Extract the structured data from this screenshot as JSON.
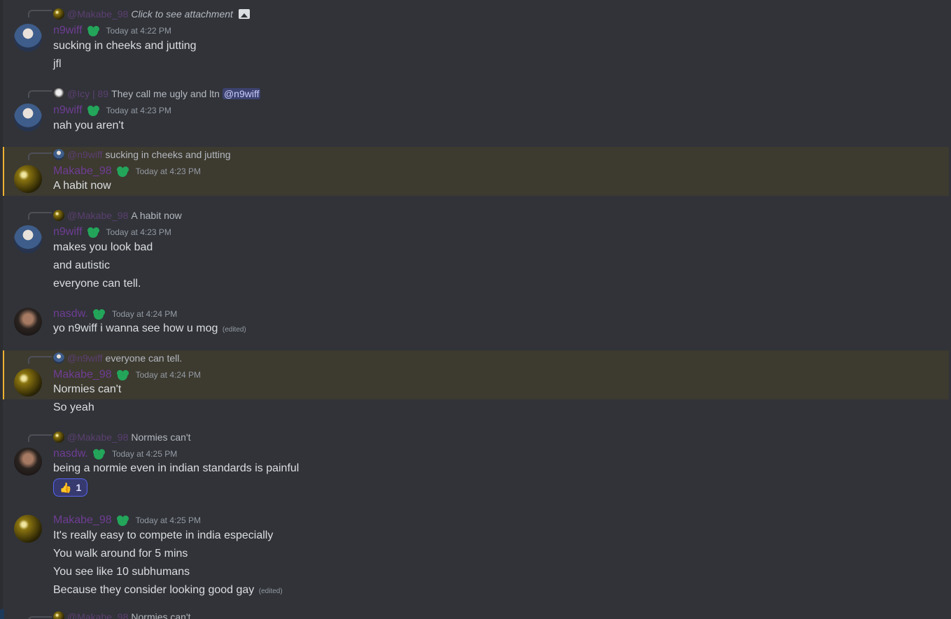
{
  "messages": [
    {
      "reply": {
        "user": "@Makabe_98",
        "text": "Click to see attachment",
        "italic": true,
        "has_image_icon": true
      },
      "user": "n9wiff",
      "timestamp": "Today at 4:22 PM",
      "lines": [
        "sucking in cheeks and jutting",
        "jfl"
      ]
    },
    {
      "reply": {
        "user": "@Icy | 89",
        "text": "They call me ugly and ltn",
        "mention": "@n9wiff"
      },
      "user": "n9wiff",
      "timestamp": "Today at 4:23 PM",
      "lines": [
        "nah you aren't"
      ]
    },
    {
      "highlighted": true,
      "reply": {
        "user": "@n9wiff",
        "text": "sucking in cheeks and jutting"
      },
      "user": "Makabe_98",
      "timestamp": "Today at 4:23 PM",
      "lines": [
        "A habit now"
      ]
    },
    {
      "reply": {
        "user": "@Makabe_98",
        "text": "A habit now"
      },
      "user": "n9wiff",
      "timestamp": "Today at 4:23 PM",
      "lines": [
        "makes you look bad",
        "and autistic",
        "everyone can tell."
      ]
    },
    {
      "user": "nasdw.",
      "timestamp": "Today at 4:24 PM",
      "lines": [
        "yo n9wiff i wanna see how u mog"
      ],
      "edited_label": "(edited)"
    },
    {
      "highlighted": true,
      "reply": {
        "user": "@n9wiff",
        "text": "everyone can tell."
      },
      "user": "Makabe_98",
      "timestamp": "Today at 4:24 PM",
      "lines": [
        "Normies can't",
        "So yeah"
      ]
    },
    {
      "reply": {
        "user": "@Makabe_98",
        "text": "Normies can't"
      },
      "user": "nasdw.",
      "timestamp": "Today at 4:25 PM",
      "lines": [
        "being a normie even in indian standards is painful"
      ],
      "reaction": {
        "emoji": "👍",
        "count": "1"
      }
    },
    {
      "user": "Makabe_98",
      "timestamp": "Today at 4:25 PM",
      "lines": [
        "It's really easy to compete in india especially",
        "You walk around for 5 mins",
        "You see like 10 subhumans",
        "Because they consider looking good gay"
      ],
      "edited_label": "(edited)"
    },
    {
      "reply": {
        "user": "@Makabe_98",
        "text": "Normies can't"
      }
    }
  ]
}
